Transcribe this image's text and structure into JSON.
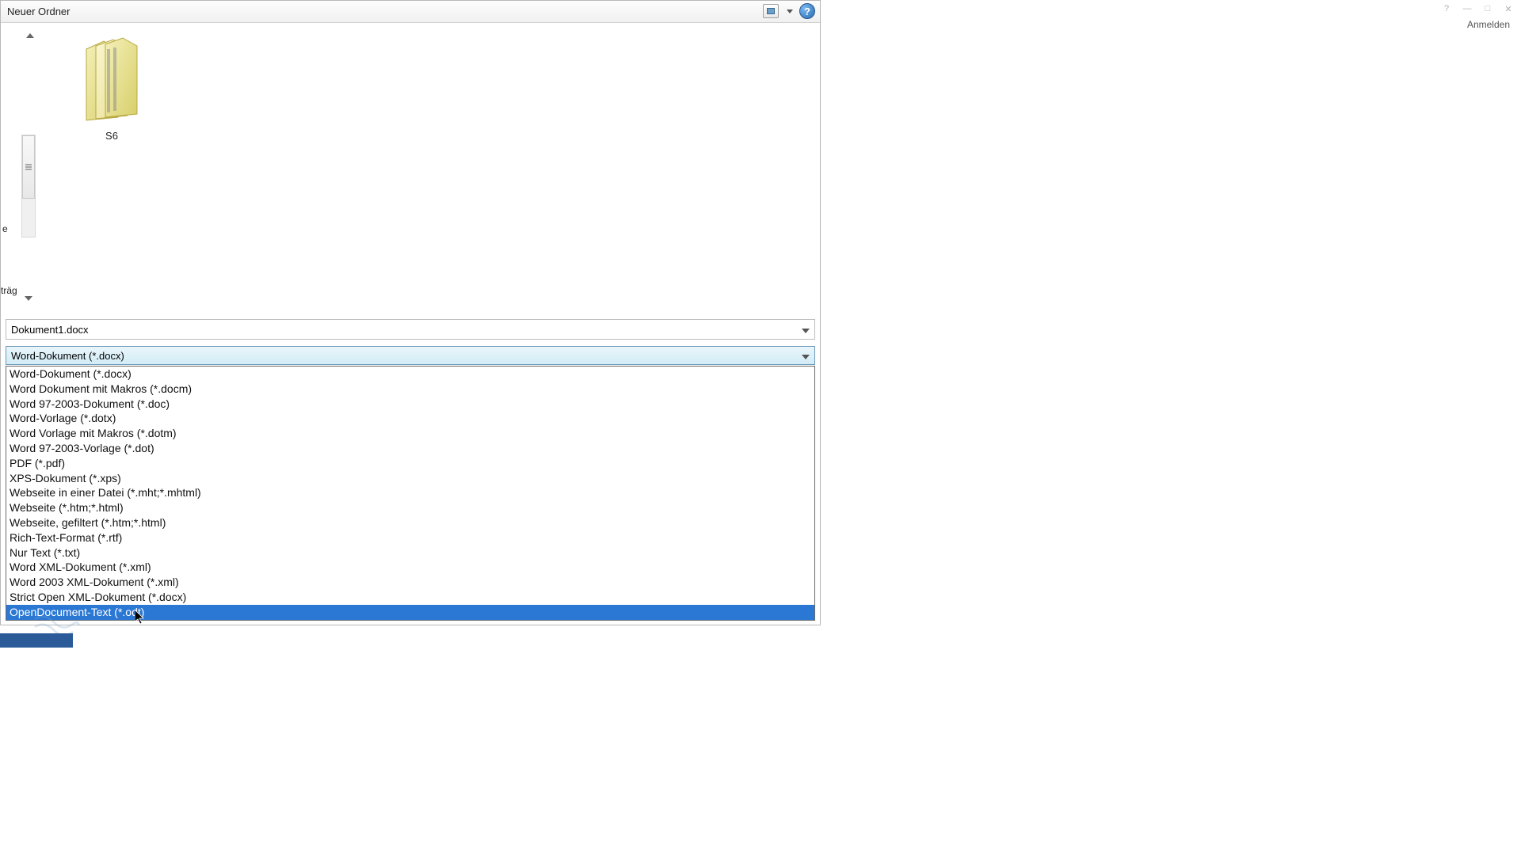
{
  "bg": {
    "anmelden": "Anmelden"
  },
  "dialog": {
    "title": "Neuer Ordner",
    "folder_name": "S6",
    "partial1": "e",
    "partial2": "träg"
  },
  "filename": {
    "value": "Dokument1.docx"
  },
  "filetype": {
    "selected": "Word-Dokument (*.docx)",
    "options": [
      "Word-Dokument (*.docx)",
      "Word Dokument mit Makros (*.docm)",
      "Word 97-2003-Dokument (*.doc)",
      "Word-Vorlage (*.dotx)",
      "Word Vorlage mit Makros (*.dotm)",
      "Word 97-2003-Vorlage (*.dot)",
      "PDF (*.pdf)",
      "XPS-Dokument (*.xps)",
      "Webseite in einer Datei (*.mht;*.mhtml)",
      "Webseite (*.htm;*.html)",
      "Webseite, gefiltert (*.htm;*.html)",
      "Rich-Text-Format (*.rtf)",
      "Nur Text (*.txt)",
      "Word XML-Dokument (*.xml)",
      "Word 2003 XML-Dokument (*.xml)",
      "Strict Open XML-Dokument (*.docx)",
      "OpenDocument-Text (*.odt)"
    ],
    "hovered_index": 16
  }
}
